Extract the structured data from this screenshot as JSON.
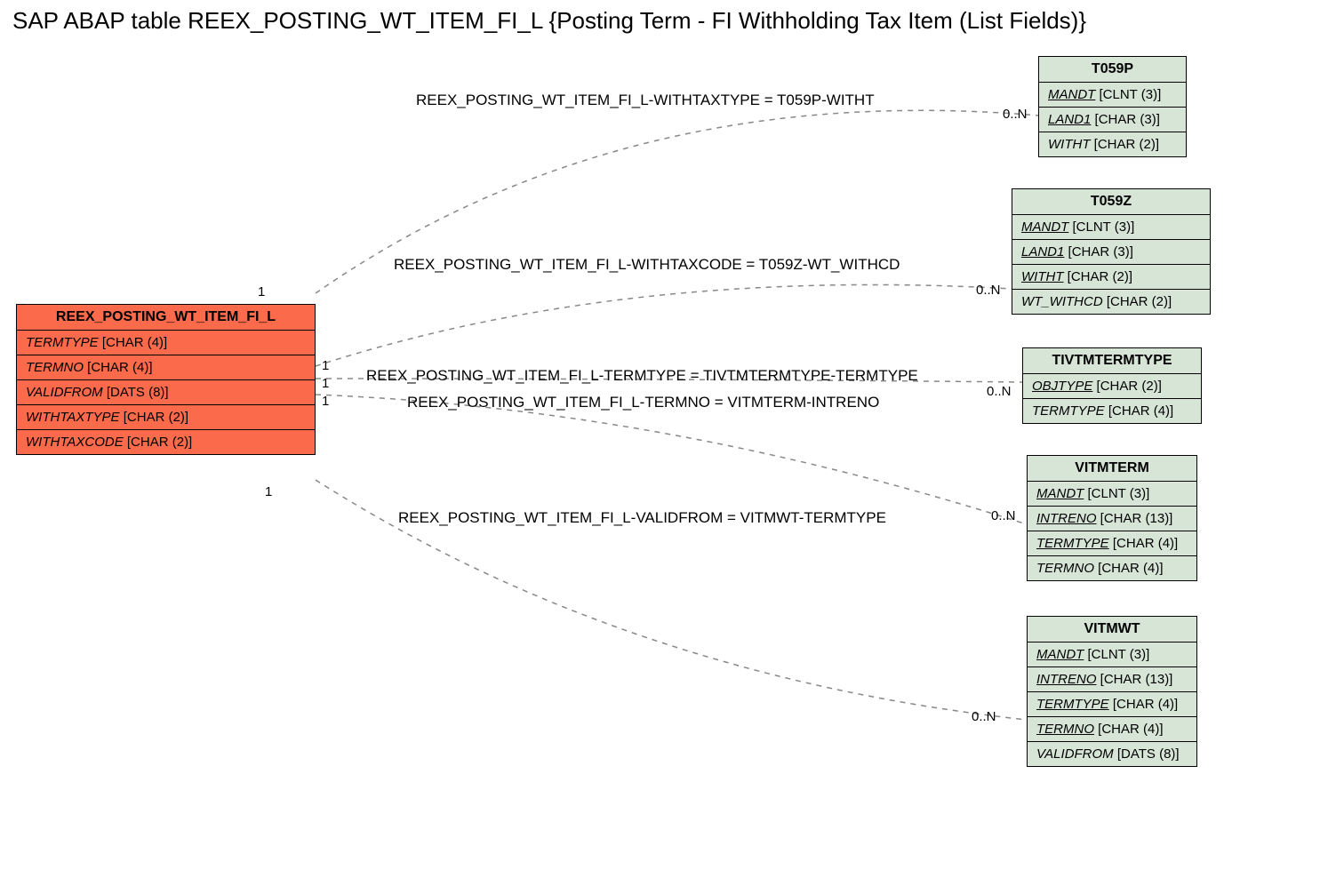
{
  "title": "SAP ABAP table REEX_POSTING_WT_ITEM_FI_L {Posting Term - FI Withholding Tax Item (List Fields)}",
  "main": {
    "name": "REEX_POSTING_WT_ITEM_FI_L",
    "fields": [
      {
        "name": "TERMTYPE",
        "type": "[CHAR (4)]",
        "underline": false
      },
      {
        "name": "TERMNO",
        "type": "[CHAR (4)]",
        "underline": false
      },
      {
        "name": "VALIDFROM",
        "type": "[DATS (8)]",
        "underline": false
      },
      {
        "name": "WITHTAXTYPE",
        "type": "[CHAR (2)]",
        "underline": false
      },
      {
        "name": "WITHTAXCODE",
        "type": "[CHAR (2)]",
        "underline": false
      }
    ]
  },
  "refs": [
    {
      "name": "T059P",
      "fields": [
        {
          "name": "MANDT",
          "type": "[CLNT (3)]",
          "underline": true
        },
        {
          "name": "LAND1",
          "type": "[CHAR (3)]",
          "underline": true
        },
        {
          "name": "WITHT",
          "type": "[CHAR (2)]",
          "underline": false
        }
      ]
    },
    {
      "name": "T059Z",
      "fields": [
        {
          "name": "MANDT",
          "type": "[CLNT (3)]",
          "underline": true
        },
        {
          "name": "LAND1",
          "type": "[CHAR (3)]",
          "underline": true
        },
        {
          "name": "WITHT",
          "type": "[CHAR (2)]",
          "underline": true
        },
        {
          "name": "WT_WITHCD",
          "type": "[CHAR (2)]",
          "underline": false
        }
      ]
    },
    {
      "name": "TIVTMTERMTYPE",
      "fields": [
        {
          "name": "OBJTYPE",
          "type": "[CHAR (2)]",
          "underline": true
        },
        {
          "name": "TERMTYPE",
          "type": "[CHAR (4)]",
          "underline": false
        }
      ]
    },
    {
      "name": "VITMTERM",
      "fields": [
        {
          "name": "MANDT",
          "type": "[CLNT (3)]",
          "underline": true
        },
        {
          "name": "INTRENO",
          "type": "[CHAR (13)]",
          "underline": true
        },
        {
          "name": "TERMTYPE",
          "type": "[CHAR (4)]",
          "underline": true
        },
        {
          "name": "TERMNO",
          "type": "[CHAR (4)]",
          "underline": false
        }
      ]
    },
    {
      "name": "VITMWT",
      "fields": [
        {
          "name": "MANDT",
          "type": "[CLNT (3)]",
          "underline": true
        },
        {
          "name": "INTRENO",
          "type": "[CHAR (13)]",
          "underline": true
        },
        {
          "name": "TERMTYPE",
          "type": "[CHAR (4)]",
          "underline": true
        },
        {
          "name": "TERMNO",
          "type": "[CHAR (4)]",
          "underline": true
        },
        {
          "name": "VALIDFROM",
          "type": "[DATS (8)]",
          "underline": false
        }
      ]
    }
  ],
  "rels": [
    {
      "label": "REEX_POSTING_WT_ITEM_FI_L-WITHTAXTYPE = T059P-WITHT",
      "left_card": "1",
      "right_card": "0..N"
    },
    {
      "label": "REEX_POSTING_WT_ITEM_FI_L-WITHTAXCODE = T059Z-WT_WITHCD",
      "left_card": "1",
      "right_card": "0..N"
    },
    {
      "label": "REEX_POSTING_WT_ITEM_FI_L-TERMTYPE = TIVTMTERMTYPE-TERMTYPE",
      "left_card": "1",
      "right_card": "0..N"
    },
    {
      "label": "REEX_POSTING_WT_ITEM_FI_L-TERMNO = VITMTERM-INTRENO",
      "left_card": "1",
      "right_card": "0..N"
    },
    {
      "label": "REEX_POSTING_WT_ITEM_FI_L-VALIDFROM = VITMWT-TERMTYPE",
      "left_card": "1",
      "right_card": "0..N"
    }
  ]
}
